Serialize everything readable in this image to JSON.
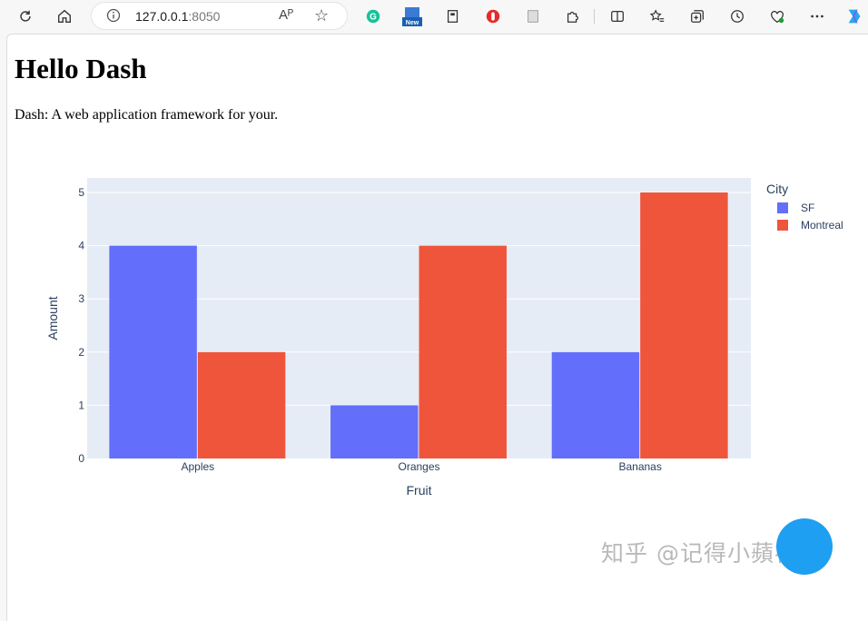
{
  "browser": {
    "url_host": "127.0.0.1",
    "url_port": ":8050",
    "read_aloud_label": "Aᴾ",
    "new_badge": "New"
  },
  "page": {
    "title": "Hello Dash",
    "description": "Dash: A web application framework for your."
  },
  "watermark": "知乎 @记得小蘋初见",
  "colors": {
    "sf": "#636efa",
    "montreal": "#ef553b",
    "plot_bg": "#e5ecf6"
  },
  "chart_data": {
    "type": "bar",
    "categories": [
      "Apples",
      "Oranges",
      "Bananas"
    ],
    "series": [
      {
        "name": "SF",
        "values": [
          4,
          1,
          2
        ]
      },
      {
        "name": "Montreal",
        "values": [
          2,
          4,
          5
        ]
      }
    ],
    "xlabel": "Fruit",
    "ylabel": "Amount",
    "legend_title": "City",
    "ylim": [
      0,
      5
    ],
    "yticks": [
      "0",
      "1",
      "2",
      "3",
      "4",
      "5"
    ],
    "grid": true,
    "barmode": "group",
    "legend_position": "top-right"
  }
}
